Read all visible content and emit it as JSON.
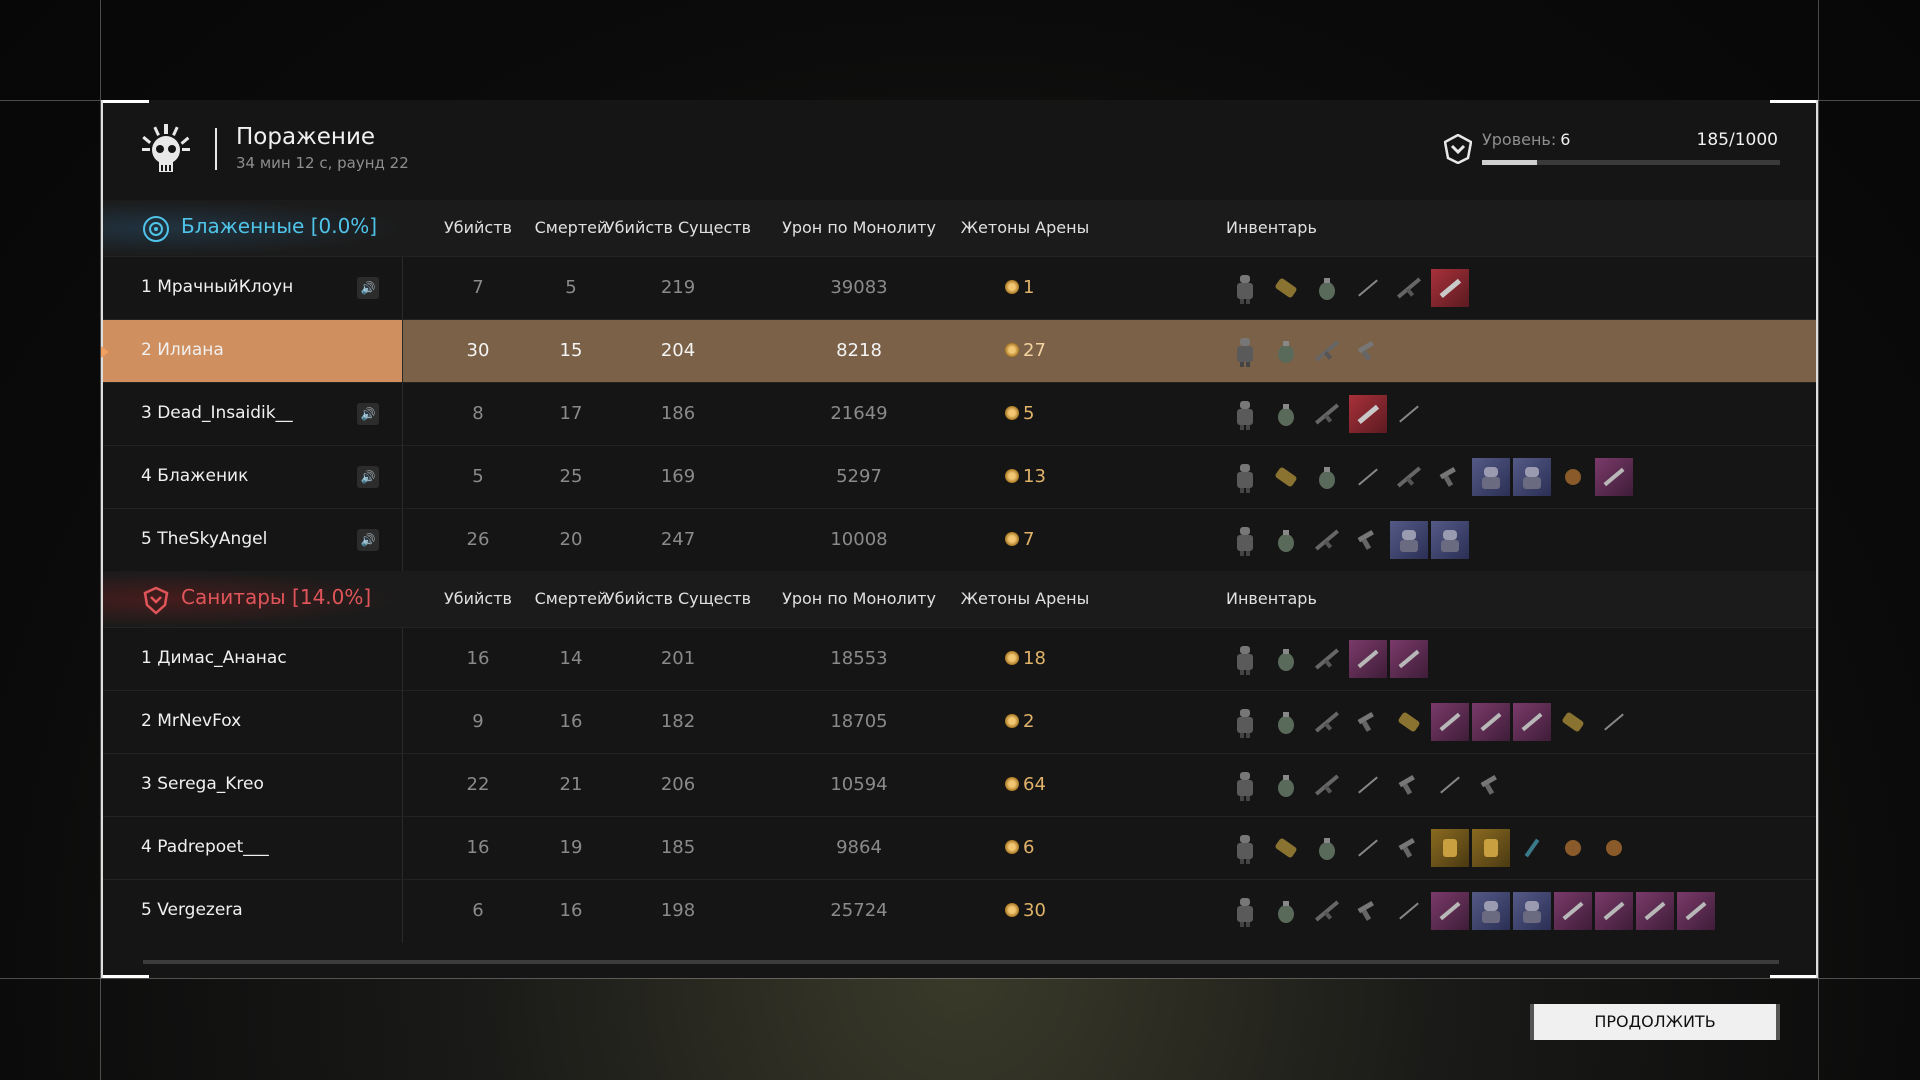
{
  "header": {
    "title": "Поражение",
    "subtitle": "34 мин 12 с, раунд 22",
    "level_label": "Уровень:",
    "level_value": "6",
    "xp_text": "185/1000",
    "xp_fraction": 0.185
  },
  "columns": [
    "Убийств",
    "Смертей",
    "Убийств Существ",
    "Урон по Монолиту",
    "Жетоны Арены",
    "Инвентарь"
  ],
  "teams": [
    {
      "name": "Блаженные [0.0%]",
      "color": "#4fc3e8",
      "players": [
        {
          "name": "1 МрачныйКлоун",
          "kills": "7",
          "deaths": "5",
          "creatures": "219",
          "monolith": "39083",
          "tokens": "1",
          "muted": true,
          "self": false,
          "inventory": [
            "armor",
            "ammo",
            "grenade",
            "knife",
            "rifle",
            "red"
          ]
        },
        {
          "name": "2 Илиана",
          "kills": "30",
          "deaths": "15",
          "creatures": "204",
          "monolith": "8218",
          "tokens": "27",
          "muted": false,
          "self": true,
          "inventory": [
            "armor",
            "grenade",
            "rifle",
            "pistol"
          ]
        },
        {
          "name": "3 Dead_Insaidik__",
          "kills": "8",
          "deaths": "17",
          "creatures": "186",
          "monolith": "21649",
          "tokens": "5",
          "muted": true,
          "self": false,
          "inventory": [
            "armor",
            "grenade",
            "rifle",
            "red",
            "knife"
          ]
        },
        {
          "name": "4 Блаженик",
          "kills": "5",
          "deaths": "25",
          "creatures": "169",
          "monolith": "5297",
          "tokens": "13",
          "muted": true,
          "self": false,
          "inventory": [
            "armor",
            "ammo",
            "grenade",
            "knife",
            "rifle",
            "pistol",
            "hl",
            "hl",
            "orb",
            "pink"
          ]
        },
        {
          "name": "5 TheSkyAngel",
          "kills": "26",
          "deaths": "20",
          "creatures": "247",
          "monolith": "10008",
          "tokens": "7",
          "muted": true,
          "self": false,
          "inventory": [
            "armor",
            "grenade",
            "rifle",
            "pistol",
            "hl",
            "hl"
          ]
        }
      ]
    },
    {
      "name": "Санитары [14.0%]",
      "color": "#e0555a",
      "players": [
        {
          "name": "1 Димас_Ананас",
          "kills": "16",
          "deaths": "14",
          "creatures": "201",
          "monolith": "18553",
          "tokens": "18",
          "muted": false,
          "self": false,
          "inventory": [
            "armor",
            "grenade",
            "rifle",
            "pink",
            "pink"
          ]
        },
        {
          "name": "2 MrNevFox",
          "kills": "9",
          "deaths": "16",
          "creatures": "182",
          "monolith": "18705",
          "tokens": "2",
          "muted": false,
          "self": false,
          "inventory": [
            "armor",
            "grenade",
            "rifle",
            "pistol",
            "ammo",
            "pink",
            "pink",
            "pink",
            "ammo",
            "knife"
          ]
        },
        {
          "name": "3 Serega_Kreo",
          "kills": "22",
          "deaths": "21",
          "creatures": "206",
          "monolith": "10594",
          "tokens": "64",
          "muted": false,
          "self": false,
          "inventory": [
            "armor",
            "grenade",
            "rifle",
            "knife",
            "pistol",
            "knife",
            "pistol"
          ]
        },
        {
          "name": "4 Padrepoet___",
          "kills": "16",
          "deaths": "19",
          "creatures": "185",
          "monolith": "9864",
          "tokens": "6",
          "muted": false,
          "self": false,
          "inventory": [
            "armor",
            "ammo",
            "grenade",
            "knife",
            "pistol",
            "gold",
            "gold",
            "syringe",
            "orb",
            "orb"
          ]
        },
        {
          "name": "5 Vergezera",
          "kills": "6",
          "deaths": "16",
          "creatures": "198",
          "monolith": "25724",
          "tokens": "30",
          "muted": false,
          "self": false,
          "inventory": [
            "armor",
            "grenade",
            "rifle",
            "pistol",
            "knife",
            "pink",
            "hl",
            "hl",
            "pink",
            "pink",
            "pink",
            "pink"
          ]
        }
      ]
    }
  ],
  "continue_label": "ПРОДОЛЖИТЬ"
}
